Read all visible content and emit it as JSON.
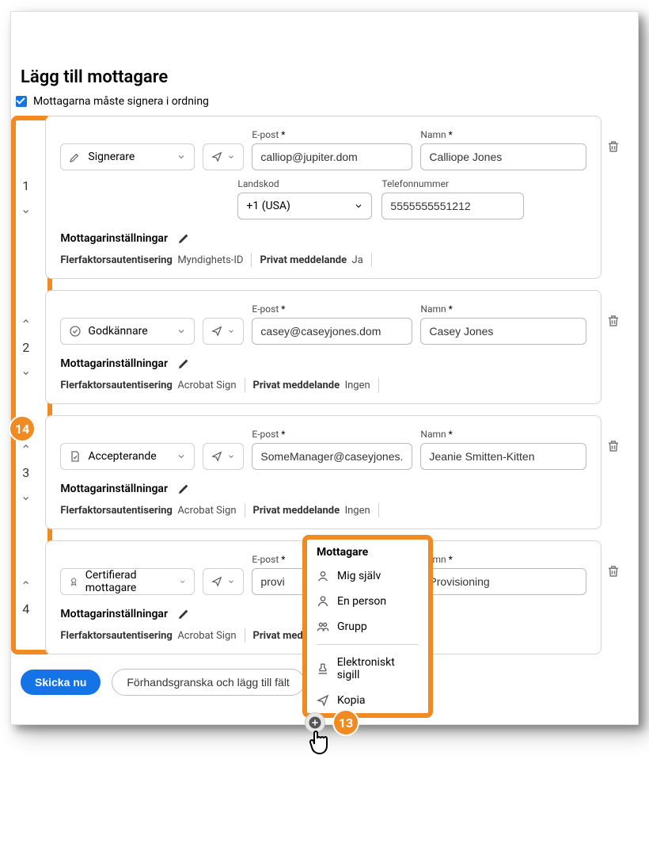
{
  "heading": "Lägg till mottagare",
  "order_check_label": "Mottagarna måste signera i ordning",
  "labels": {
    "email": "E-post",
    "name": "Namn",
    "country_code": "Landskod",
    "phone": "Telefonnummer",
    "recipient_settings": "Mottagarinställningar",
    "mfa": "Flerfaktorsautentisering",
    "priv_msg": "Privat meddelande"
  },
  "recipients": [
    {
      "num": "1",
      "role": "Signerare",
      "email": "calliop@jupiter.dom",
      "name": "Calliope Jones",
      "show_phone": true,
      "country_code": "+1 (USA)",
      "phone": "5555555551212",
      "mfa": "Myndighets-ID",
      "priv_msg": "Ja",
      "up": false,
      "down": true
    },
    {
      "num": "2",
      "role": "Godkännare",
      "email": "casey@caseyjones.dom",
      "name": "Casey Jones",
      "show_phone": false,
      "mfa": "Acrobat Sign",
      "priv_msg": "Ingen",
      "up": true,
      "down": true
    },
    {
      "num": "3",
      "role": "Accepterande",
      "email": "SomeManager@caseyjones.dom",
      "name": "Jeanie Smitten-Kitten",
      "show_phone": false,
      "mfa": "Acrobat Sign",
      "priv_msg": "Ingen",
      "up": true,
      "down": true
    },
    {
      "num": "4",
      "role": "Certifierad mottagare",
      "email": "provi",
      "name": "Provisioning",
      "show_phone": false,
      "mfa": "Acrobat Sign",
      "priv_msg_trunc": "Privat meddela",
      "up": true,
      "down": false
    }
  ],
  "popover": {
    "title": "Mottagare",
    "items": [
      "Mig själv",
      "En person",
      "Grupp"
    ],
    "items2": [
      "Elektroniskt sigill",
      "Kopia"
    ]
  },
  "callouts": {
    "strip": "14",
    "add": "13"
  },
  "footer": {
    "send": "Skicka nu",
    "preview": "Förhandsgranska och lägg till fält"
  }
}
